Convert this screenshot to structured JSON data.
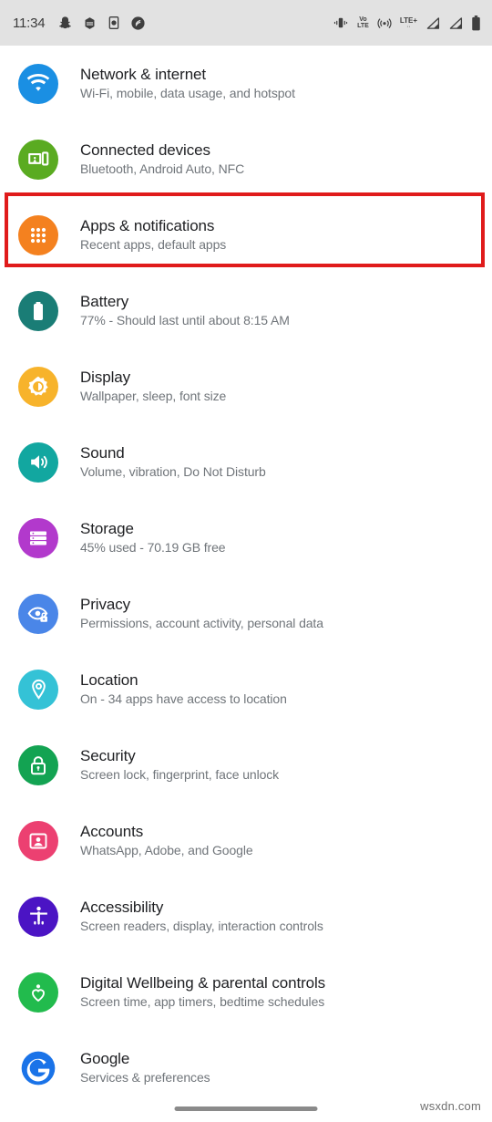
{
  "status_bar": {
    "clock": "11:34",
    "background": "#e2e2e2",
    "left_icons": [
      {
        "name": "snapchat-icon",
        "label": "Snapchat"
      },
      {
        "name": "hexagon-app-icon",
        "label": "App notification"
      },
      {
        "name": "phone-app-icon",
        "label": "Phone"
      },
      {
        "name": "shazam-icon",
        "label": "Shazam"
      }
    ],
    "right_icons": [
      {
        "name": "vibrate-icon",
        "label": "Vibrate"
      },
      {
        "name": "volte-icon",
        "label": "VoLTE",
        "line1": "Vo",
        "line2": "LTE"
      },
      {
        "name": "hotspot-icon",
        "label": "Hotspot"
      },
      {
        "name": "lte-plus-icon",
        "label": "LTE+",
        "text": "LTE+",
        "dots": "··"
      },
      {
        "name": "signal-bars-sim1-icon",
        "label": "Signal SIM 1"
      },
      {
        "name": "signal-bars-sim2-icon",
        "label": "Signal SIM 2"
      },
      {
        "name": "battery-icon",
        "label": "Battery"
      }
    ]
  },
  "settings": {
    "items": [
      {
        "id": "network-internet",
        "title": "Network & internet",
        "subtitle": "Wi-Fi, mobile, data usage, and hotspot",
        "icon": "wifi-icon",
        "color": "#1a8fe3"
      },
      {
        "id": "connected-devices",
        "title": "Connected devices",
        "subtitle": "Bluetooth, Android Auto, NFC",
        "icon": "cast-devices-icon",
        "color": "#5aab21"
      },
      {
        "id": "apps-notifications",
        "title": "Apps & notifications",
        "subtitle": "Recent apps, default apps",
        "icon": "apps-grid-icon",
        "color": "#f4811f",
        "highlighted": true
      },
      {
        "id": "battery",
        "title": "Battery",
        "subtitle": "77% - Should last until about 8:15 AM",
        "icon": "battery-icon",
        "color": "#1a7d76"
      },
      {
        "id": "display",
        "title": "Display",
        "subtitle": "Wallpaper, sleep, font size",
        "icon": "brightness-icon",
        "color": "#f7b32b"
      },
      {
        "id": "sound",
        "title": "Sound",
        "subtitle": "Volume, vibration, Do Not Disturb",
        "icon": "volume-icon",
        "color": "#12a7a0"
      },
      {
        "id": "storage",
        "title": "Storage",
        "subtitle": "45% used - 70.19 GB free",
        "icon": "storage-stack-icon",
        "color": "#b239cc"
      },
      {
        "id": "privacy",
        "title": "Privacy",
        "subtitle": "Permissions, account activity, personal data",
        "icon": "eye-lock-icon",
        "color": "#4a86e8"
      },
      {
        "id": "location",
        "title": "Location",
        "subtitle": "On - 34 apps have access to location",
        "icon": "location-pin-icon",
        "color": "#34c2d6"
      },
      {
        "id": "security",
        "title": "Security",
        "subtitle": "Screen lock, fingerprint, face unlock",
        "icon": "lock-icon",
        "color": "#13a352"
      },
      {
        "id": "accounts",
        "title": "Accounts",
        "subtitle": "WhatsApp, Adobe, and Google",
        "icon": "account-card-icon",
        "color": "#ec4071"
      },
      {
        "id": "accessibility",
        "title": "Accessibility",
        "subtitle": "Screen readers, display, interaction controls",
        "icon": "accessibility-person-icon",
        "color": "#4b14c4"
      },
      {
        "id": "digital-wellbeing",
        "title": "Digital Wellbeing & parental controls",
        "subtitle": "Screen time, app timers, bedtime schedules",
        "icon": "wellbeing-heart-icon",
        "color": "#22bb4d"
      },
      {
        "id": "google",
        "title": "Google",
        "subtitle": "Services & preferences",
        "icon": "google-g-icon",
        "color": "#1a73e8"
      }
    ]
  },
  "highlight": {
    "target": "apps-notifications",
    "color": "#e01b1b"
  },
  "watermark": {
    "text": "wsxdn.com"
  },
  "nav": {
    "handle_label": "gesture-nav-handle"
  }
}
